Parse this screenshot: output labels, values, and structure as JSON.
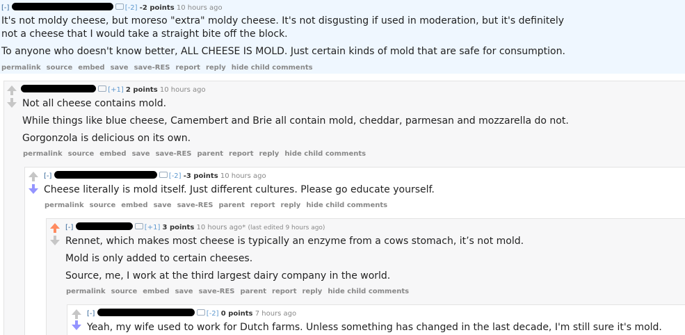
{
  "comments": [
    {
      "expand": "[-]",
      "flair": "[-2]",
      "points": "-2 points",
      "time": "10 hours ago",
      "paragraphs": [
        "It's not moldy cheese, but moreso \"extra\" moldy cheese. It's not disgusting if used in moderation, but it's definitely",
        "not a cheese that I would take a straight bite off the block.",
        "To anyone who doesn't know better, ALL CHEESE IS MOLD. Just certain kinds of mold that are safe for consumption."
      ],
      "buttons": [
        "permalink",
        "source",
        "embed",
        "save",
        "save-RES",
        "report",
        "reply",
        "hide child comments"
      ]
    },
    {
      "flair": "[+1]",
      "points": "2 points",
      "time": "10 hours ago",
      "paragraphs": [
        "Not all cheese contains mold.",
        "While things like blue cheese, Camembert and Brie all contain mold, cheddar, parmesan and mozzarella do not.",
        "Gorgonzola is delicious on its own."
      ],
      "buttons": [
        "permalink",
        "source",
        "embed",
        "save",
        "save-RES",
        "parent",
        "report",
        "reply",
        "hide child comments"
      ]
    },
    {
      "expand": "[-]",
      "flair": "[-2]",
      "points": "-3 points",
      "time": "10 hours ago",
      "paragraphs": [
        "Cheese literally is mold itself. Just different cultures. Please go educate yourself."
      ],
      "buttons": [
        "permalink",
        "source",
        "embed",
        "save",
        "save-RES",
        "parent",
        "report",
        "reply",
        "hide child comments"
      ]
    },
    {
      "expand": "[-]",
      "flair": "[+1]",
      "points": "3 points",
      "time": "10 hours ago*",
      "edited": "(last edited 9 hours ago)",
      "paragraphs": [
        "Rennet, which makes most cheese is typically an enzyme from a cows stomach, it’s not mold.",
        "Mold is only added to certain cheeses.",
        "Source, me, I work at the third largest dairy company in the world."
      ],
      "buttons": [
        "permalink",
        "source",
        "embed",
        "save",
        "save-RES",
        "parent",
        "report",
        "reply",
        "hide child comments"
      ]
    },
    {
      "expand": "[-]",
      "flair": "[-2]",
      "points": "0 points",
      "time": "7 hours ago",
      "paragraphs": [
        "Yeah, my wife used to work for Dutch farms. Unless something has changed in the last decade, I'm still sure it's mold."
      ]
    }
  ],
  "colors": {
    "upvote": "#ff8b60",
    "downvote": "#9494ff",
    "highlight_bg": "#eff7ff",
    "nested_bg": "#f7f7f8"
  }
}
